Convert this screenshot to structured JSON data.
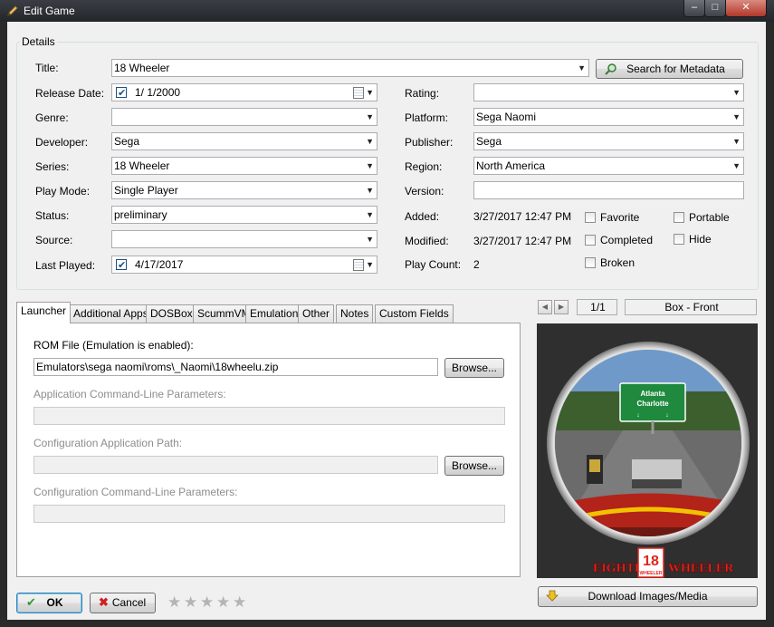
{
  "window": {
    "title": "Edit Game",
    "minimize": "–",
    "maximize": "□",
    "close": "✕"
  },
  "details": {
    "group_label": "Details",
    "title": {
      "label": "Title:",
      "value": "18 Wheeler"
    },
    "search_button": "Search for Metadata",
    "release_date": {
      "label": "Release Date:",
      "value": "1/  1/2000",
      "checked": true
    },
    "genre": {
      "label": "Genre:",
      "value": ""
    },
    "developer": {
      "label": "Developer:",
      "value": "Sega"
    },
    "series": {
      "label": "Series:",
      "value": "18 Wheeler"
    },
    "play_mode": {
      "label": "Play Mode:",
      "value": "Single Player"
    },
    "status": {
      "label": "Status:",
      "value": "preliminary"
    },
    "source": {
      "label": "Source:",
      "value": ""
    },
    "last_played": {
      "label": "Last Played:",
      "value": "4/17/2017",
      "checked": true
    },
    "rating": {
      "label": "Rating:",
      "value": ""
    },
    "platform": {
      "label": "Platform:",
      "value": "Sega Naomi"
    },
    "publisher": {
      "label": "Publisher:",
      "value": "Sega"
    },
    "region": {
      "label": "Region:",
      "value": "North America"
    },
    "version": {
      "label": "Version:",
      "value": ""
    },
    "added": {
      "label": "Added:",
      "value": "3/27/2017 12:47 PM"
    },
    "modified": {
      "label": "Modified:",
      "value": "3/27/2017 12:47 PM"
    },
    "play_count": {
      "label": "Play Count:",
      "value": "2"
    },
    "flags": {
      "favorite": "Favorite",
      "portable": "Portable",
      "completed": "Completed",
      "hide": "Hide",
      "broken": "Broken"
    }
  },
  "tabs": [
    "Launcher",
    "Additional Apps",
    "DOSBox",
    "ScummVM",
    "Emulation",
    "Other",
    "Notes",
    "Custom Fields"
  ],
  "launcher": {
    "rom_label": "ROM File (Emulation is enabled):",
    "rom_value": "Emulators\\sega naomi\\roms\\_Naomi\\18wheelu.zip",
    "browse": "Browse...",
    "app_params_label": "Application Command-Line Parameters:",
    "config_path_label": "Configuration Application Path:",
    "config_params_label": "Configuration Command-Line Parameters:"
  },
  "media": {
    "counter": "1/1",
    "type": "Box - Front",
    "sign_line1": "Atlanta",
    "sign_line2": "Charlotte",
    "logo_left": "EIGHTEEN",
    "logo_num": "18",
    "logo_small": "WHEELER",
    "logo_right": "WHEELER",
    "download_button": "Download Images/Media"
  },
  "footer": {
    "ok": "OK",
    "cancel": "Cancel",
    "rating_stars": 0
  }
}
